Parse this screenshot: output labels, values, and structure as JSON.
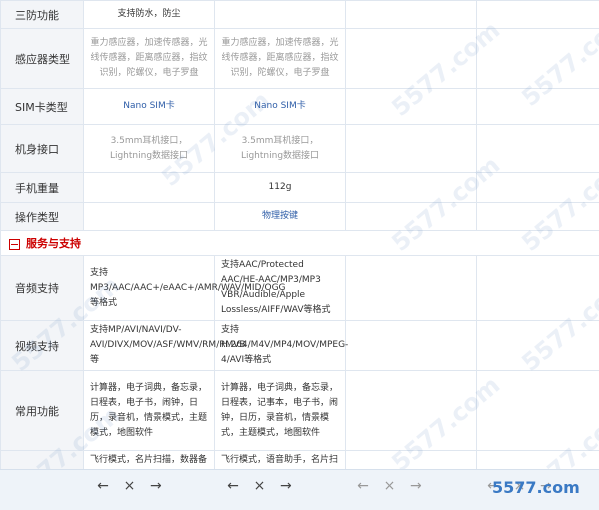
{
  "rows_top": [
    {
      "label": "三防功能",
      "c1": "支持防水，防尘",
      "c2": ""
    },
    {
      "label": "感应器类型",
      "c1": "重力感应器，加速传感器，光线传感器，距离感应器，指纹识别，陀螺仪，电子罗盘",
      "c2": "重力感应器，加速传感器，光线传感器，距离感应器，指纹识别，陀螺仪，电子罗盘"
    },
    {
      "label": "SIM卡类型",
      "c1": "Nano SIM卡",
      "c2": "Nano SIM卡"
    },
    {
      "label": "机身接口",
      "c1": "3.5mm耳机接口，Lightning数据接口",
      "c2": "3.5mm耳机接口，Lightning数据接口"
    },
    {
      "label": "手机重量",
      "c1": "",
      "c2": "112g"
    },
    {
      "label": "操作类型",
      "c1": "",
      "c2": "物理按键"
    }
  ],
  "section": {
    "title": "服务与支持"
  },
  "rows_bottom": [
    {
      "label": "音频支持",
      "c1": "支持MP3/AAC/AAC+/eAAC+/AMR/WAV/MID/OGG等格式",
      "c2": "支持AAC/Protected AAC/HE-AAC/MP3/MP3 VBR/Audible/Apple Lossless/AIFF/WAV等格式"
    },
    {
      "label": "视频支持",
      "c1": "支持MP/AVI/NAVI/DV-AVI/DIVX/MOV/ASF/WMV/RM/RMVB等",
      "c2": "支持H.264/M4V/MP4/MOV/MPEG-4/AVI等格式"
    },
    {
      "label": "常用功能",
      "c1": "计算器，电子词典，备忘录，日程表，电子书，闹钟，日历，录音机，情景模式，主题模式，地图软件",
      "c2": "计算器，电子词典，备忘录，日程表，记事本，电子书，闹钟，日历，录音机，情景模式，主题模式，地图软件"
    },
    {
      "label": "",
      "c1": "飞行模式，名片扫描，数器备",
      "c2": "飞行模式，语音助手，名片扫"
    }
  ],
  "nav": {
    "prev": "←",
    "close": "×",
    "next": "→"
  },
  "watermark": "5577.com"
}
